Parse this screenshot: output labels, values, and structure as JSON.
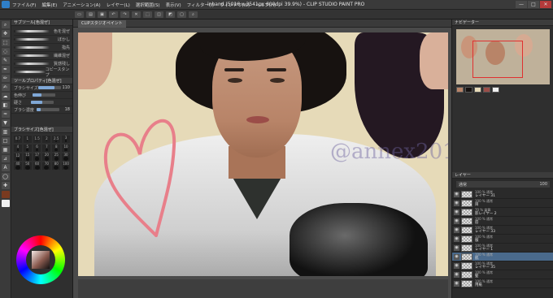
{
  "window": {
    "title": "inhand (5016 x 3541px 600dpi 39.9%) - CLIP STUDIO PAINT PRO",
    "menu": [
      "ファイル(F)",
      "編集(E)",
      "アニメーション(A)",
      "レイヤー(L)",
      "選択範囲(S)",
      "表示(V)",
      "フィルター(I)",
      "ウィンドウ(W)",
      "ヘルプ(H)"
    ],
    "buttons": [
      "—",
      "□",
      "✕"
    ]
  },
  "toolbar": {
    "icons": [
      "new-file-icon",
      "open-icon",
      "save-icon",
      "undo-icon",
      "redo-icon",
      "clear-icon",
      "transform-icon",
      "deselect-icon",
      "invert-icon",
      "border-icon",
      "zoom-icon"
    ]
  },
  "canvas_tab": {
    "label": "CLIPスタジオペイント"
  },
  "left_panel": {
    "sub_tool_header": "サブツール[色混ぜ]",
    "brushes": [
      {
        "label": "色を混ぜ"
      },
      {
        "label": "ぼかし"
      },
      {
        "label": "指先"
      },
      {
        "label": "繊維混ぜ"
      },
      {
        "label": "質感残し"
      },
      {
        "label": "コピースタンプ"
      }
    ],
    "tool_property_header": "ツールプロパティ[色混ぜ]",
    "props": [
      {
        "label": "ブラシサイズ",
        "value": "110",
        "level": 0.7
      },
      {
        "label": "色伸び",
        "value": "",
        "level": 0.4
      },
      {
        "label": "硬さ",
        "value": "",
        "level": 0.5
      },
      {
        "label": "ブラシ濃度",
        "value": "18",
        "level": 0.18
      }
    ],
    "brush_size_header": "ブラシサイズ[色混ぜ]",
    "sizes": [
      "0.7",
      "1",
      "1.5",
      "2",
      "2.5",
      "3",
      "4",
      "5",
      "6",
      "7",
      "8",
      "10",
      "12",
      "15",
      "17",
      "20",
      "25",
      "30",
      "40",
      "50",
      "60",
      "70",
      "80",
      "100"
    ]
  },
  "watermark": "@annex2019",
  "right_panel": {
    "navigator_header": "ナビゲーター",
    "layer_header": "レイヤー",
    "blend": "通常",
    "opacity": "100",
    "layers": [
      {
        "pct": "100 % 通常",
        "name": "レイヤー 31"
      },
      {
        "pct": "100 % 通常",
        "name": "目"
      },
      {
        "pct": "70 % 乗算",
        "name": "影レイヤー 2"
      },
      {
        "pct": "100 % 通常",
        "name": "唇"
      },
      {
        "pct": "100 % 通常",
        "name": "レイヤー 33"
      },
      {
        "pct": "100 % 通常",
        "name": "服"
      },
      {
        "pct": "100 % 通常",
        "name": "レイヤー 1"
      },
      {
        "pct": "100 % 通常",
        "name": "肌"
      },
      {
        "pct": "100 % 通常",
        "name": "レイヤー 35"
      },
      {
        "pct": "100 % 通常",
        "name": "髪"
      },
      {
        "pct": "100 % 通常",
        "name": "用紙"
      }
    ],
    "selected_layer_index": 7
  },
  "colors": {
    "heart": "#e87f8a",
    "selection": "#4a6a8c",
    "canvas_bg": "#e6dab8"
  }
}
